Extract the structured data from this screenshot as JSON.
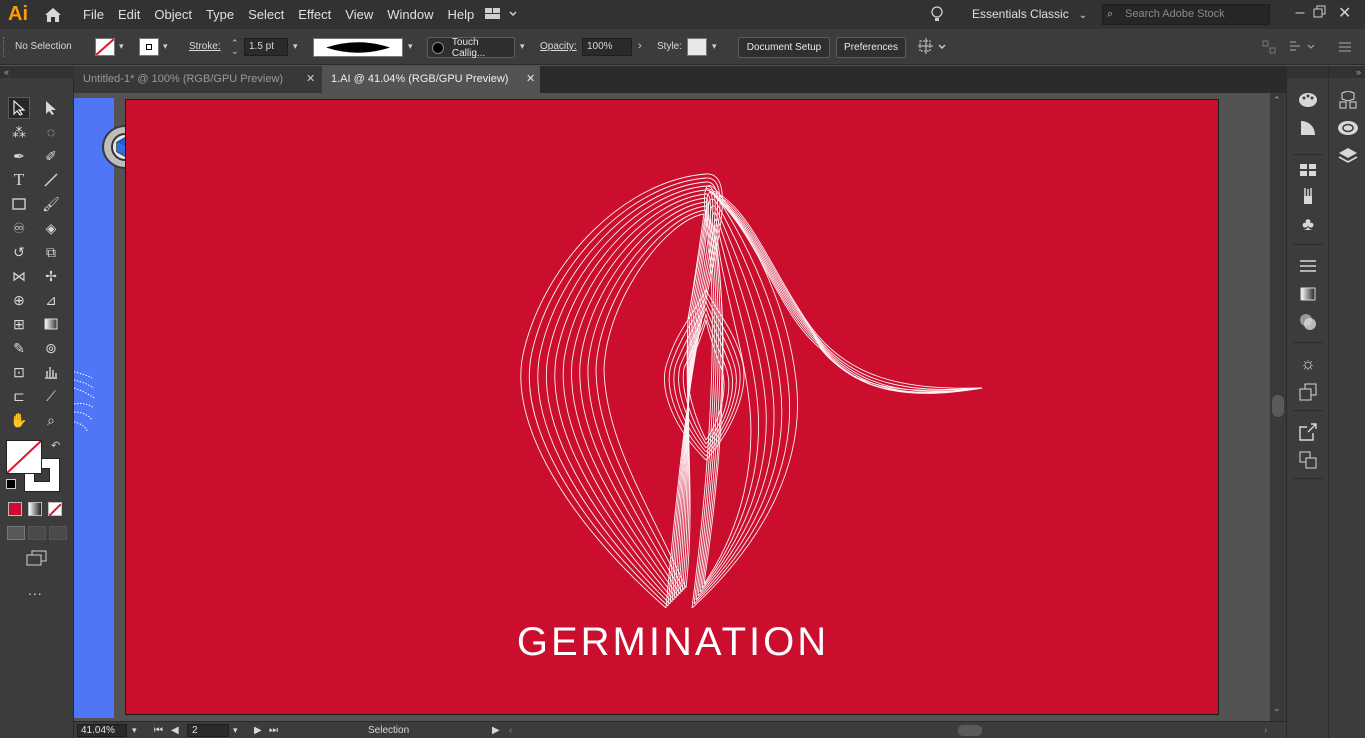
{
  "app": {
    "logo_text": "Ai",
    "menus": [
      "File",
      "Edit",
      "Object",
      "Type",
      "Select",
      "Effect",
      "View",
      "Window",
      "Help"
    ],
    "workspace": "Essentials Classic",
    "search_placeholder": "Search Adobe Stock"
  },
  "controlbar": {
    "selection_status": "No Selection",
    "stroke_label": "Stroke:",
    "stroke_weight": "1.5 pt",
    "brush_name": "Touch Callig...",
    "opacity_label": "Opacity:",
    "opacity_value": "100%",
    "style_label": "Style:",
    "document_setup_label": "Document Setup",
    "preferences_label": "Preferences"
  },
  "tabs": [
    {
      "label": "Untitled-1* @ 100% (RGB/GPU Preview)",
      "active": false
    },
    {
      "label": "1.AI @ 41.04% (RGB/GPU Preview)",
      "active": true
    }
  ],
  "artboard": {
    "background_color": "#cb0e2e",
    "title": "GERMINATION"
  },
  "statusbar": {
    "zoom": "41.04%",
    "artboard_number": "2",
    "current_tool": "Selection"
  },
  "colors": {
    "accent": "#ff9a00",
    "left_artboard": "#4f76f6",
    "fill_swatch": "#cb0e2e"
  },
  "icons": {
    "more_tools": "..."
  }
}
